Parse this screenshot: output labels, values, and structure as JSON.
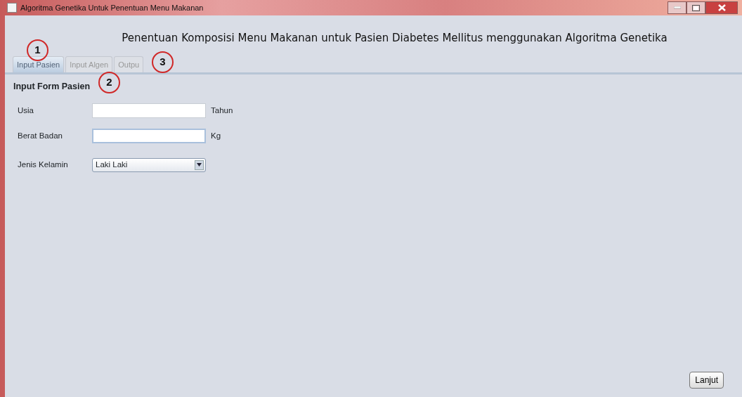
{
  "window": {
    "title": "Algoritma Genetika Untuk Penentuan Menu Makanan"
  },
  "heading": "Penentuan Komposisi Menu Makanan untuk Pasien Diabetes Mellitus menggunakan Algoritma Genetika",
  "tabs": [
    {
      "label": "Input Pasien",
      "selected": true
    },
    {
      "label": "Input Algen",
      "selected": false
    },
    {
      "label": "Outpu",
      "selected": false
    }
  ],
  "form": {
    "title": "Input Form Pasien",
    "fields": [
      {
        "kind": "text",
        "label": "Usia",
        "unit": "Tahun",
        "focused": false
      },
      {
        "kind": "text",
        "label": "Berat Badan",
        "unit": "Kg",
        "focused": true
      },
      {
        "kind": "select",
        "label": "Jenis Kelamin",
        "value": "Laki Laki"
      }
    ]
  },
  "button": "Lanjut",
  "annotations": [
    {
      "label": "1"
    },
    {
      "label": "2"
    },
    {
      "label": "3"
    }
  ]
}
